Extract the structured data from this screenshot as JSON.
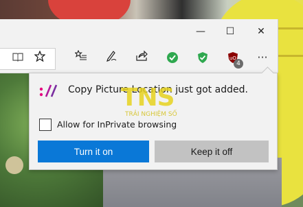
{
  "window": {
    "minimize_glyph": "—",
    "maximize_glyph": "☐",
    "close_glyph": "✕"
  },
  "toolbar": {
    "reading_view_icon": "book-icon",
    "favorite_icon": "star-icon",
    "favorites_hub_icon": "favorites-list-icon",
    "notes_icon": "pen-icon",
    "share_icon": "share-icon",
    "ext_green_icon": "check-circle-icon",
    "ext_shield_icon": "shield-icon",
    "ublock_icon": "ublock-icon",
    "ublock_badge": "4",
    "more_glyph": "···"
  },
  "popup": {
    "message": "Copy Picture Location just got added.",
    "checkbox_label": "Allow for InPrivate browsing",
    "checkbox_checked": false,
    "primary_button": "Turn it on",
    "secondary_button": "Keep it off"
  },
  "watermark": {
    "logo_text": "TNS",
    "tagline": "TRẢI NGHIỆM SỐ"
  },
  "colors": {
    "accent": "#0a78d7",
    "secondary_button": "#c2c2c2",
    "popup_bg": "#f2f2f2",
    "logo_pink": "#e6007e",
    "logo_purple": "#7a2ea0"
  }
}
